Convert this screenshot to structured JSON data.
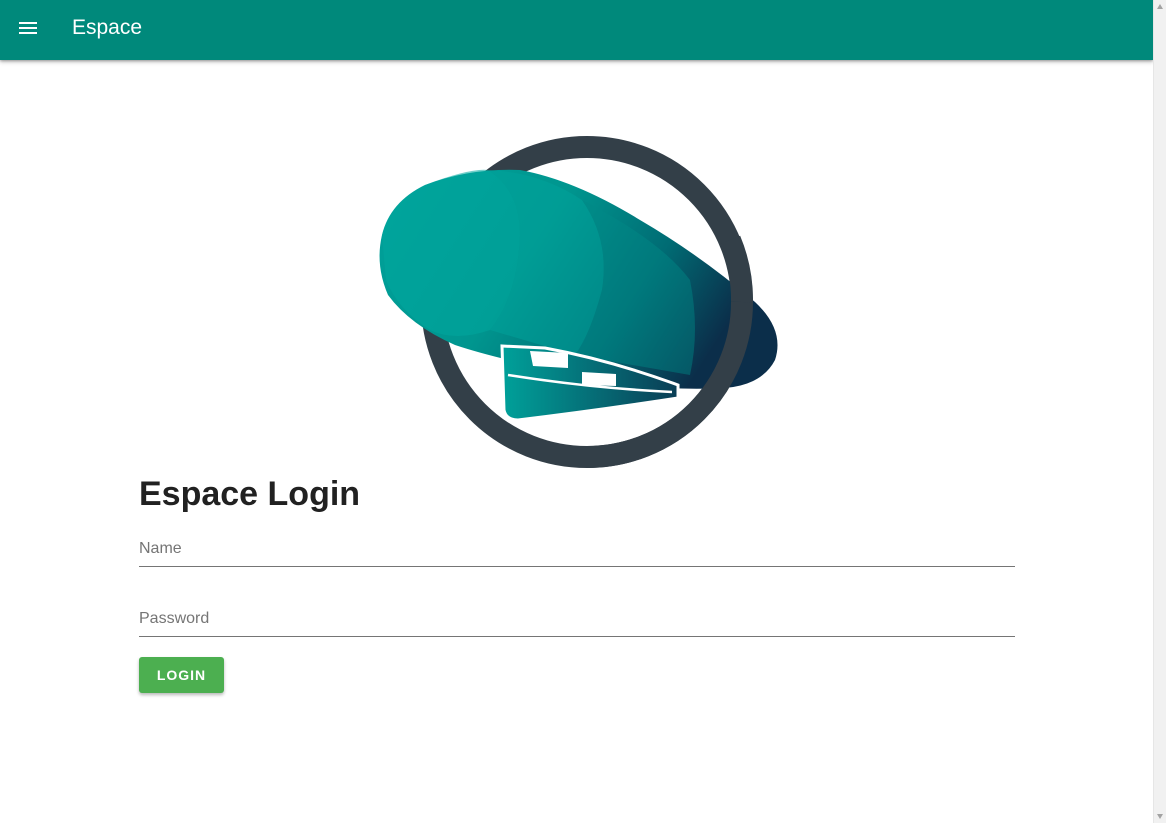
{
  "appbar": {
    "title": "Espace",
    "menu_icon": "menu-icon",
    "background": "#00897b"
  },
  "logo": {
    "icon": "espace-logo-icon"
  },
  "login": {
    "title": "Espace Login",
    "name_placeholder": "Name",
    "name_value": "",
    "password_placeholder": "Password",
    "password_value": "",
    "button_label": "LOGIN",
    "button_color": "#4caf50"
  }
}
